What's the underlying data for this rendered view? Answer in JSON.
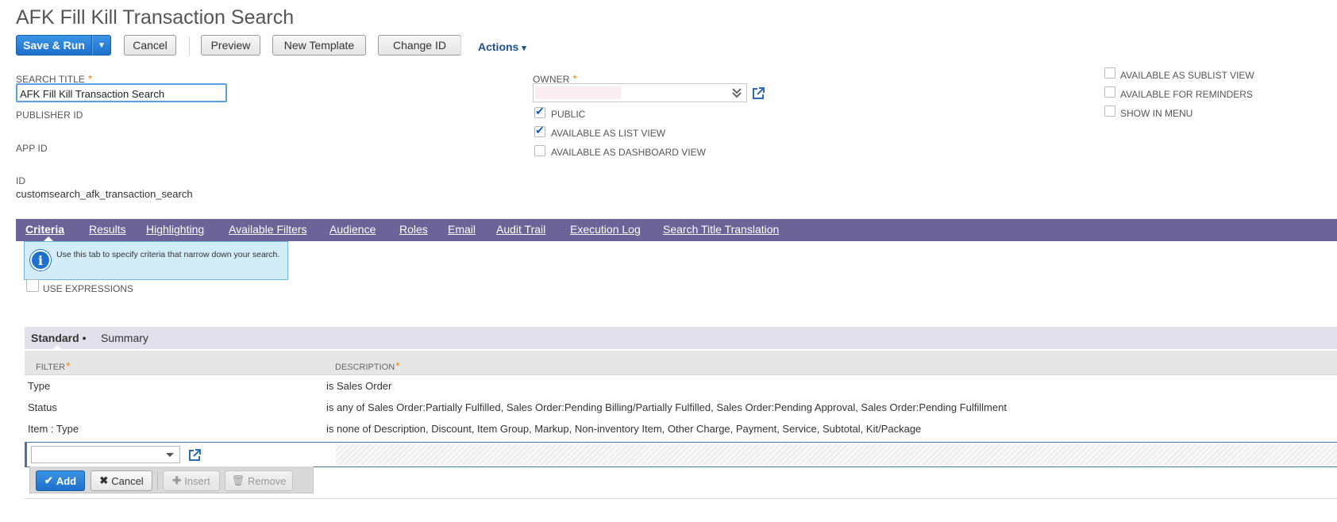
{
  "page_title": "AFK Fill Kill Transaction Search",
  "toolbar": {
    "save_run": "Save & Run",
    "dropdown_arrow": "▼",
    "cancel": "Cancel",
    "preview": "Preview",
    "new_template": "New Template",
    "change_id": "Change ID",
    "actions": "Actions",
    "actions_caret": "▾"
  },
  "form": {
    "search_title_label": "SEARCH TITLE",
    "required_mark": "*",
    "search_title_value": "AFK Fill Kill Transaction Search",
    "publisher_id_label": "PUBLISHER ID",
    "app_id_label": "APP ID",
    "id_label": "ID",
    "id_value": "customsearch_afk_transaction_search",
    "owner_label": "OWNER",
    "owner_value": "",
    "public_label": "PUBLIC",
    "public_checked": true,
    "list_view_label": "AVAILABLE AS LIST VIEW",
    "list_view_checked": true,
    "dashboard_view_label": "AVAILABLE AS DASHBOARD VIEW",
    "dashboard_view_checked": false,
    "sublist_view_label": "AVAILABLE AS SUBLIST VIEW",
    "reminders_label": "AVAILABLE FOR REMINDERS",
    "show_in_menu_label": "SHOW IN MENU"
  },
  "tabs": [
    {
      "label": "Criteria",
      "active": true
    },
    {
      "label": "Results"
    },
    {
      "label": "Highlighting"
    },
    {
      "label": "Available Filters"
    },
    {
      "label": "Audience"
    },
    {
      "label": "Roles"
    },
    {
      "label": "Email"
    },
    {
      "label": "Audit Trail"
    },
    {
      "label": "Execution Log"
    },
    {
      "label": "Search Title Translation"
    }
  ],
  "info_text": "Use this tab to specify criteria that narrow down your search.",
  "use_expressions_label": "USE EXPRESSIONS",
  "subtabs": [
    {
      "label": "Standard •",
      "active": true
    },
    {
      "label": "Summary"
    }
  ],
  "criteria_table": {
    "headers": [
      "FILTER",
      "DESCRIPTION"
    ],
    "rows": [
      {
        "filter": "Type",
        "description": "is Sales Order"
      },
      {
        "filter": "Status",
        "description": "is any of Sales Order:Partially Fulfilled, Sales Order:Pending Billing/Partially Fulfilled, Sales Order:Pending Approval, Sales Order:Pending Fulfillment"
      },
      {
        "filter": "Item : Type",
        "description": "is none of Description, Discount, Item Group, Markup, Non-inventory Item, Other Charge, Payment, Service, Subtotal, Kit/Package"
      }
    ]
  },
  "row_actions": {
    "add": "Add",
    "cancel": "Cancel",
    "insert": "Insert",
    "remove": "Remove"
  },
  "colors": {
    "tab_bar": "#6c6399",
    "primary_button": "#1d70cc",
    "required": "#e88c1e",
    "info_bg": "#d2ecf8"
  }
}
